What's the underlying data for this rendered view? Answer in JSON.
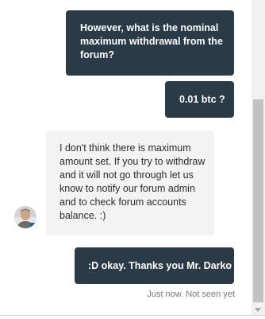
{
  "conversation": {
    "messages": [
      {
        "from": "user",
        "text": "However, what is the nominal maximum withdrawal from the forum?"
      },
      {
        "from": "user",
        "text": "0.01 btc ?"
      },
      {
        "from": "agent",
        "text": "I don't think there is maximum amount set. If you try to withdraw and it will not go through let us know to notify our forum admin and to check forum accounts balance. :)"
      },
      {
        "from": "user",
        "text": ":D okay. Thanks you Mr. Darko"
      }
    ],
    "status": "Just now. Not seen yet"
  },
  "colors": {
    "outgoing_bubble": "#2b3a47",
    "incoming_bubble": "#f3f3f3",
    "status_text": "#7a7a7a"
  },
  "icons": {
    "avatar": "agent-avatar",
    "scroll_down": "chevron-down-icon"
  }
}
